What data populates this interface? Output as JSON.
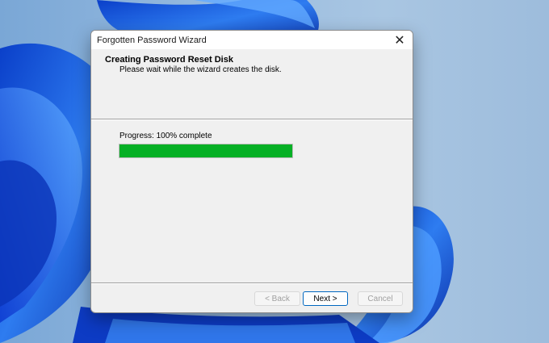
{
  "window": {
    "title": "Forgotten Password Wizard",
    "close_icon": "close-icon"
  },
  "header": {
    "title": "Creating Password Reset Disk",
    "subtitle": "Please wait while the wizard creates the disk."
  },
  "progress": {
    "label": "Progress: 100% complete",
    "value": 1.0,
    "color": "#06b025"
  },
  "buttons": {
    "back_label": "< Back",
    "next_label": "Next >",
    "cancel_label": "Cancel"
  },
  "wallpaper": {
    "accent": "#1f5fe0",
    "sky": "#9bbde0"
  }
}
